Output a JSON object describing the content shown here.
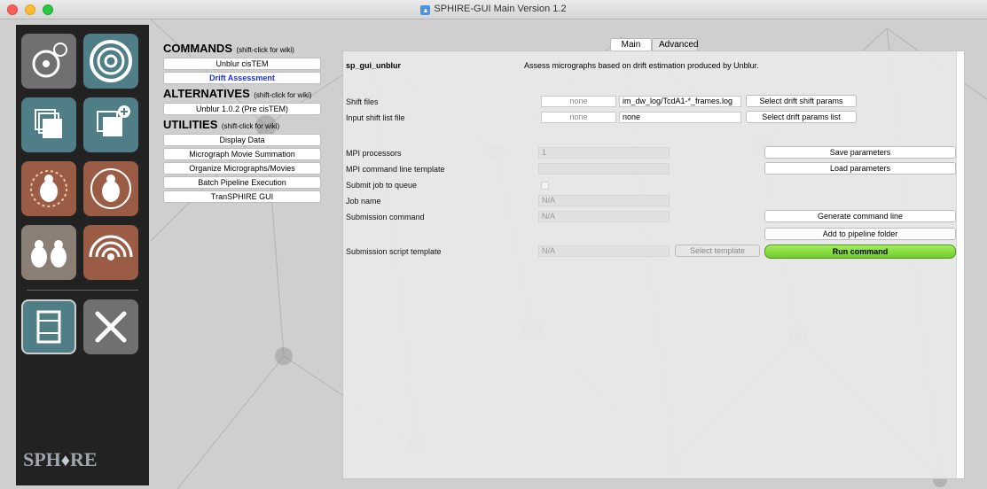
{
  "window": {
    "title": "SPHIRE-GUI Main Version 1.2"
  },
  "sidebar": {
    "tiles": [
      {
        "icon": "gears-icon",
        "color": "#707070"
      },
      {
        "icon": "target-icon",
        "color": "#4f7e86"
      },
      {
        "icon": "stack-icon",
        "color": "#4f7e86"
      },
      {
        "icon": "stack-add-icon",
        "color": "#4f7e86"
      },
      {
        "icon": "particle-burst-icon",
        "color": "#9a5c44"
      },
      {
        "icon": "particle-rotate-icon",
        "color": "#9a5c44"
      },
      {
        "icon": "particles-pair-icon",
        "color": "#8a7f74"
      },
      {
        "icon": "signal-icon",
        "color": "#9a5c44"
      },
      {
        "icon": "film-icon",
        "color": "#4f7e86"
      },
      {
        "icon": "tools-icon",
        "color": "#707070"
      }
    ],
    "logo": {
      "left": "SPH",
      "right": "RE"
    }
  },
  "commands": {
    "header": "COMMANDS",
    "hint": "(shift-click for wiki)",
    "items": [
      "Unblur cisTEM",
      "Drift Assessment"
    ]
  },
  "alternatives": {
    "header": "ALTERNATIVES",
    "hint": "(shift-click for wiki)",
    "items": [
      "Unblur 1.0.2 (Pre cisTEM)"
    ]
  },
  "utilities": {
    "header": "UTILITIES",
    "hint": "(shift-click for wiki)",
    "items": [
      "Display Data",
      "Micrograph Movie Summation",
      "Organize Micrographs/Movies",
      "Batch Pipeline Execution",
      "TranSPHIRE GUI"
    ]
  },
  "tabs": {
    "main": "Main",
    "advanced": "Advanced"
  },
  "program": {
    "name": "sp_gui_unblur",
    "description": "Assess micrographs based on drift estimation produced by Unblur."
  },
  "form": {
    "shift_files": {
      "label": "Shift files",
      "none": "none",
      "value": "im_dw_log/TcdA1-*_frames.log",
      "button": "Select drift shift params"
    },
    "input_shift_list": {
      "label": "Input shift list file",
      "none": "none",
      "value": "none",
      "button": "Select drift params list"
    },
    "mpi_processors": {
      "label": "MPI processors",
      "value": "1"
    },
    "mpi_template": {
      "label": "MPI command line template",
      "value": ""
    },
    "submit_queue": {
      "label": "Submit job to queue"
    },
    "job_name": {
      "label": "Job name",
      "value": "N/A"
    },
    "submission_command": {
      "label": "Submission command",
      "value": "N/A"
    },
    "submission_script": {
      "label": "Submission script template",
      "value": "N/A",
      "button": "Select template"
    }
  },
  "actions": {
    "save": "Save parameters",
    "load": "Load parameters",
    "generate": "Generate command line",
    "add_pipeline": "Add to pipeline folder",
    "run": "Run command"
  }
}
